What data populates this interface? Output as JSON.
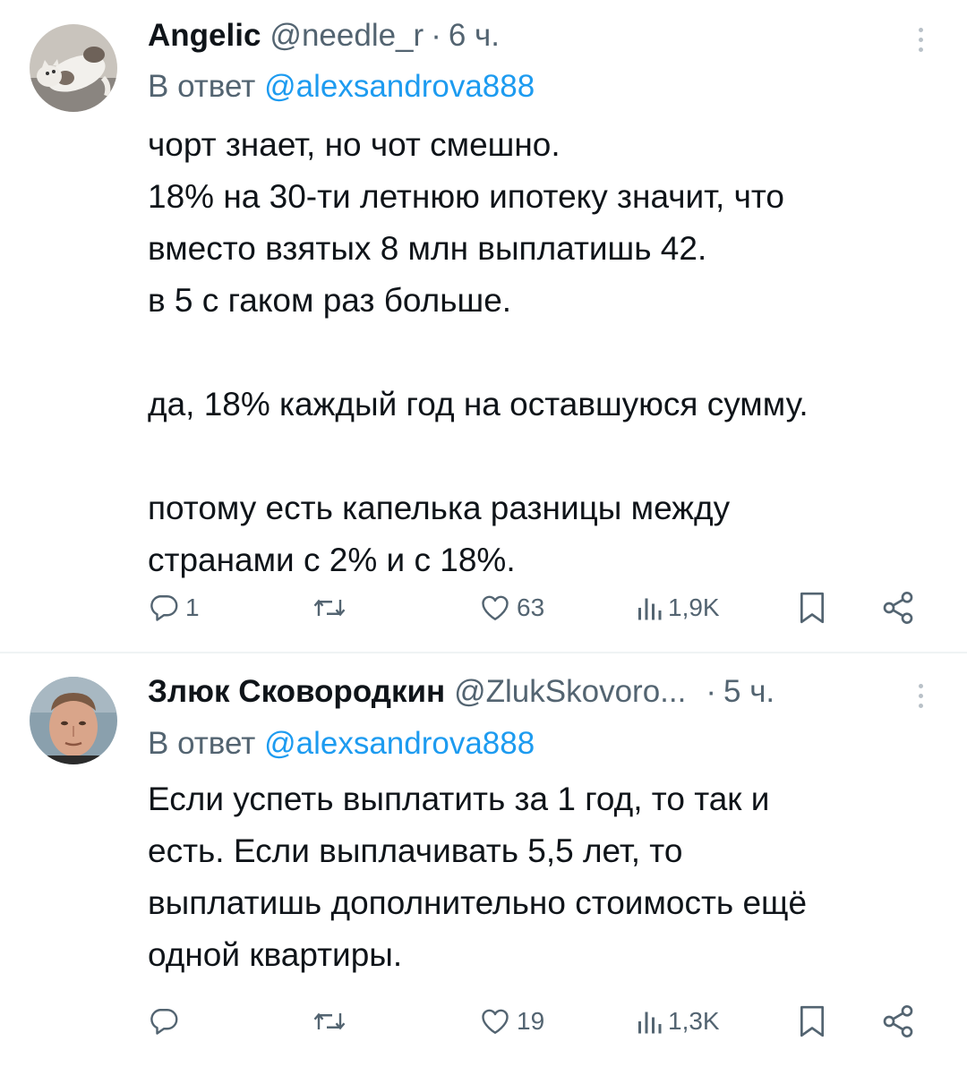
{
  "tweets": [
    {
      "display_name": "Angelic",
      "handle": "@needle_r",
      "separator": "·",
      "time": "6 ч.",
      "reply_prefix": "В ответ",
      "reply_mention": "@alexsandrova888",
      "avatar_icon": "cat-avatar",
      "text_lines": [
        "чорт знает, но чот смешно.",
        "18% на 30-ти летнюю ипотеку значит, что",
        "вместо взятых 8 млн выплатишь 42.",
        "в 5 с гаком раз больше.",
        "",
        "да, 18% каждый год на оставшуюся сумму.",
        "",
        "потому есть капелька разницы между",
        "странами с 2% и с 18%."
      ],
      "actions": {
        "replies": "1",
        "retweets": "",
        "likes": "63",
        "views": "1,9K"
      }
    },
    {
      "display_name": "Злюк Сковородкин",
      "handle": "@ZlukSkovoro...",
      "separator": "·",
      "time": "5 ч.",
      "reply_prefix": "В ответ",
      "reply_mention": "@alexsandrova888",
      "avatar_icon": "person-avatar",
      "text_lines": [
        "Если успеть выплатить за 1 год, то так и",
        "есть. Если выплачивать 5,5 лет, то",
        "выплатишь дополнительно стоимость ещё",
        "одной квартиры."
      ],
      "actions": {
        "replies": "",
        "retweets": "",
        "likes": "19",
        "views": "1,3K"
      }
    }
  ],
  "colors": {
    "text": "#0f1419",
    "secondary": "#536471",
    "accent": "#1d9bf0",
    "divider": "#eff3f4"
  }
}
